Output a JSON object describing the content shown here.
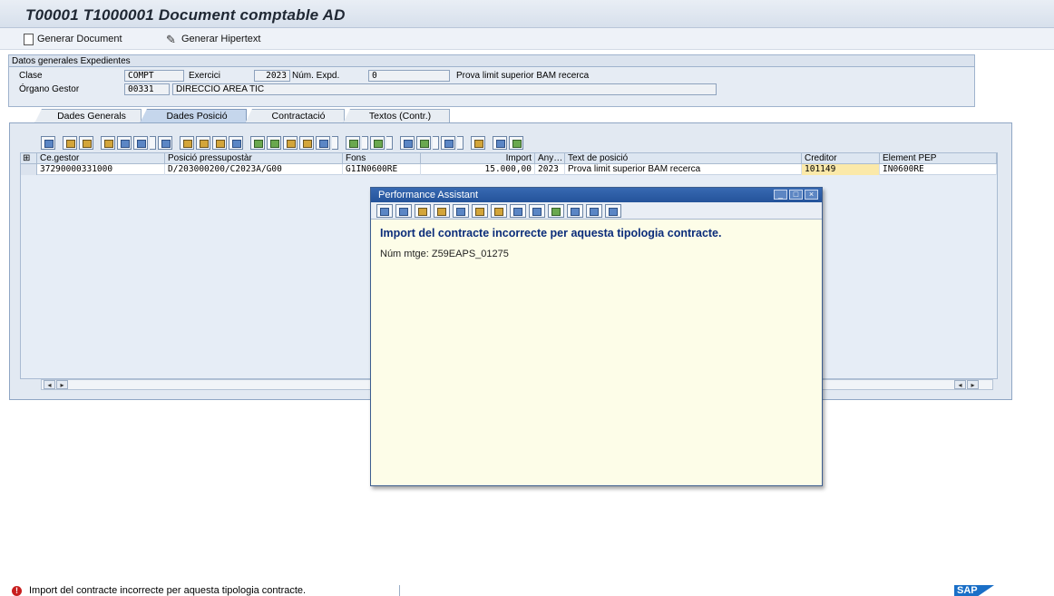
{
  "window": {
    "title": "T00001 T1000001 Document comptable AD"
  },
  "toolbar": {
    "generar_document": "Generar Document",
    "generar_hipertext": "Generar Hipertext"
  },
  "header_group": {
    "title": "Datos generales Expedientes",
    "clase_label": "Clase",
    "clase_value": "COMPT",
    "exercici_label": "Exercici",
    "exercici_value": "2023",
    "num_expd_label": "Núm. Expd.",
    "num_expd_value": "0",
    "expd_desc": "Prova limit superior BAM recerca",
    "organo_label": "Órgano Gestor",
    "organo_code": "00331",
    "organo_desc": "DIRECCIÓ ÀREA TIC"
  },
  "tabs": [
    {
      "label": "Dades Generals",
      "active": false
    },
    {
      "label": "Dades Posició",
      "active": true
    },
    {
      "label": "Contractació",
      "active": false
    },
    {
      "label": "Textos (Contr.)",
      "active": false
    }
  ],
  "grid": {
    "columns": [
      "Ce.gestor",
      "Posició pressupostàr",
      "Fons",
      "Import",
      "Any…",
      "Text de posició",
      "Creditor",
      "Element PEP"
    ],
    "rows": [
      [
        "37290000331000",
        "D/203000200/C2023A/G00",
        "G1IN0600RE",
        "15.000,00",
        "2023",
        "Prova limit superior BAM recerca",
        "101149",
        "IN0600RE"
      ]
    ]
  },
  "dialog": {
    "title": "Performance Assistant",
    "heading": "Import del contracte incorrecte per aquesta tipologia contracte.",
    "message": "Núm mtge: Z59EAPS_01275"
  },
  "status": {
    "type_color": "#c81e1e",
    "text": "Import del contracte incorrecte per aquesta tipologia contracte.",
    "logo": "SAP"
  }
}
